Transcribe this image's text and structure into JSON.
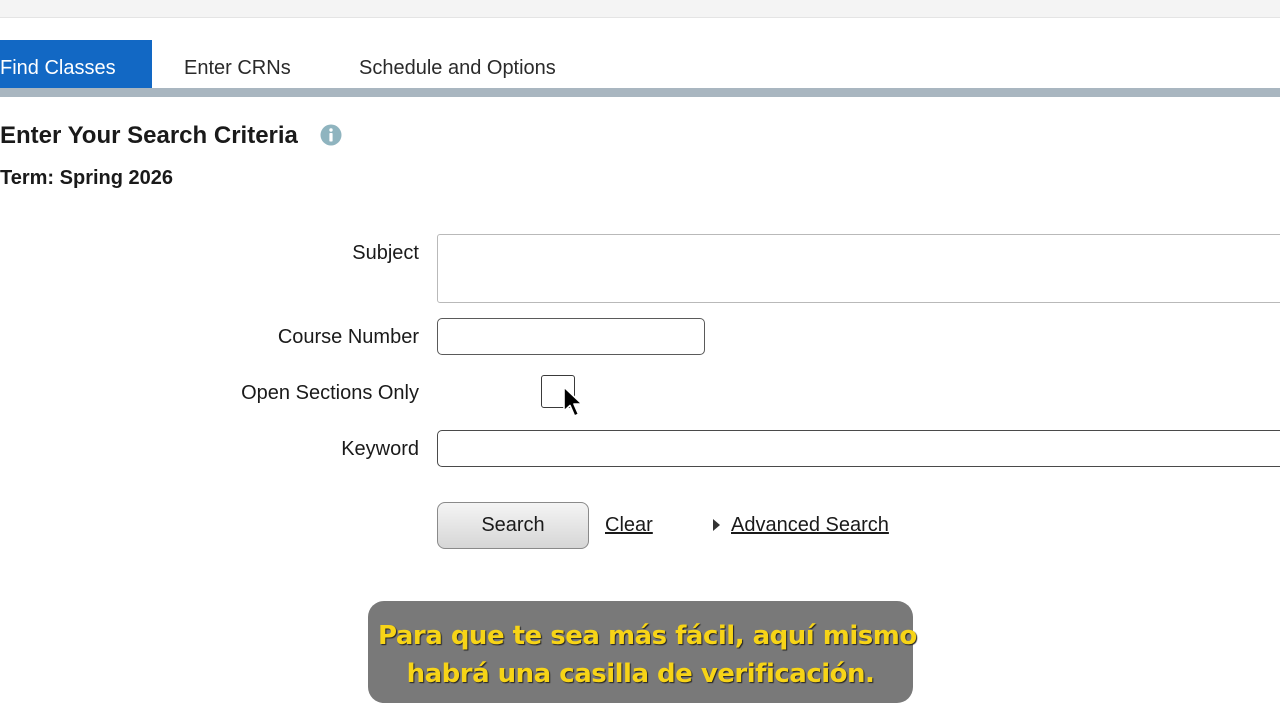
{
  "tabs": [
    {
      "label": "Find Classes",
      "active": true
    },
    {
      "label": "Enter CRNs",
      "active": false
    },
    {
      "label": "Schedule and Options",
      "active": false
    }
  ],
  "main": {
    "heading": "Enter Your Search Criteria",
    "term": "Term: Spring 2026"
  },
  "form": {
    "subject_label": "Subject",
    "subject_value": "",
    "course_number_label": "Course Number",
    "course_number_value": "",
    "open_sections_label": "Open Sections Only",
    "open_sections_checked": false,
    "keyword_label": "Keyword",
    "keyword_value": ""
  },
  "actions": {
    "search_label": "Search",
    "clear_label": "Clear",
    "advanced_label": "Advanced Search"
  },
  "subtitle": {
    "line1": "Para que te sea más fácil, aquí mismo",
    "line2": "habrá una casilla de verificación."
  },
  "colors": {
    "active_tab": "#1268c4",
    "tab_underline": "#a9b6c0",
    "subtitle_text": "#f7d417",
    "info_icon": "#8fb4bf"
  },
  "icons": {
    "info": "info-icon",
    "cursor": "mouse-pointer-icon",
    "advanced": "caret-right-icon"
  }
}
